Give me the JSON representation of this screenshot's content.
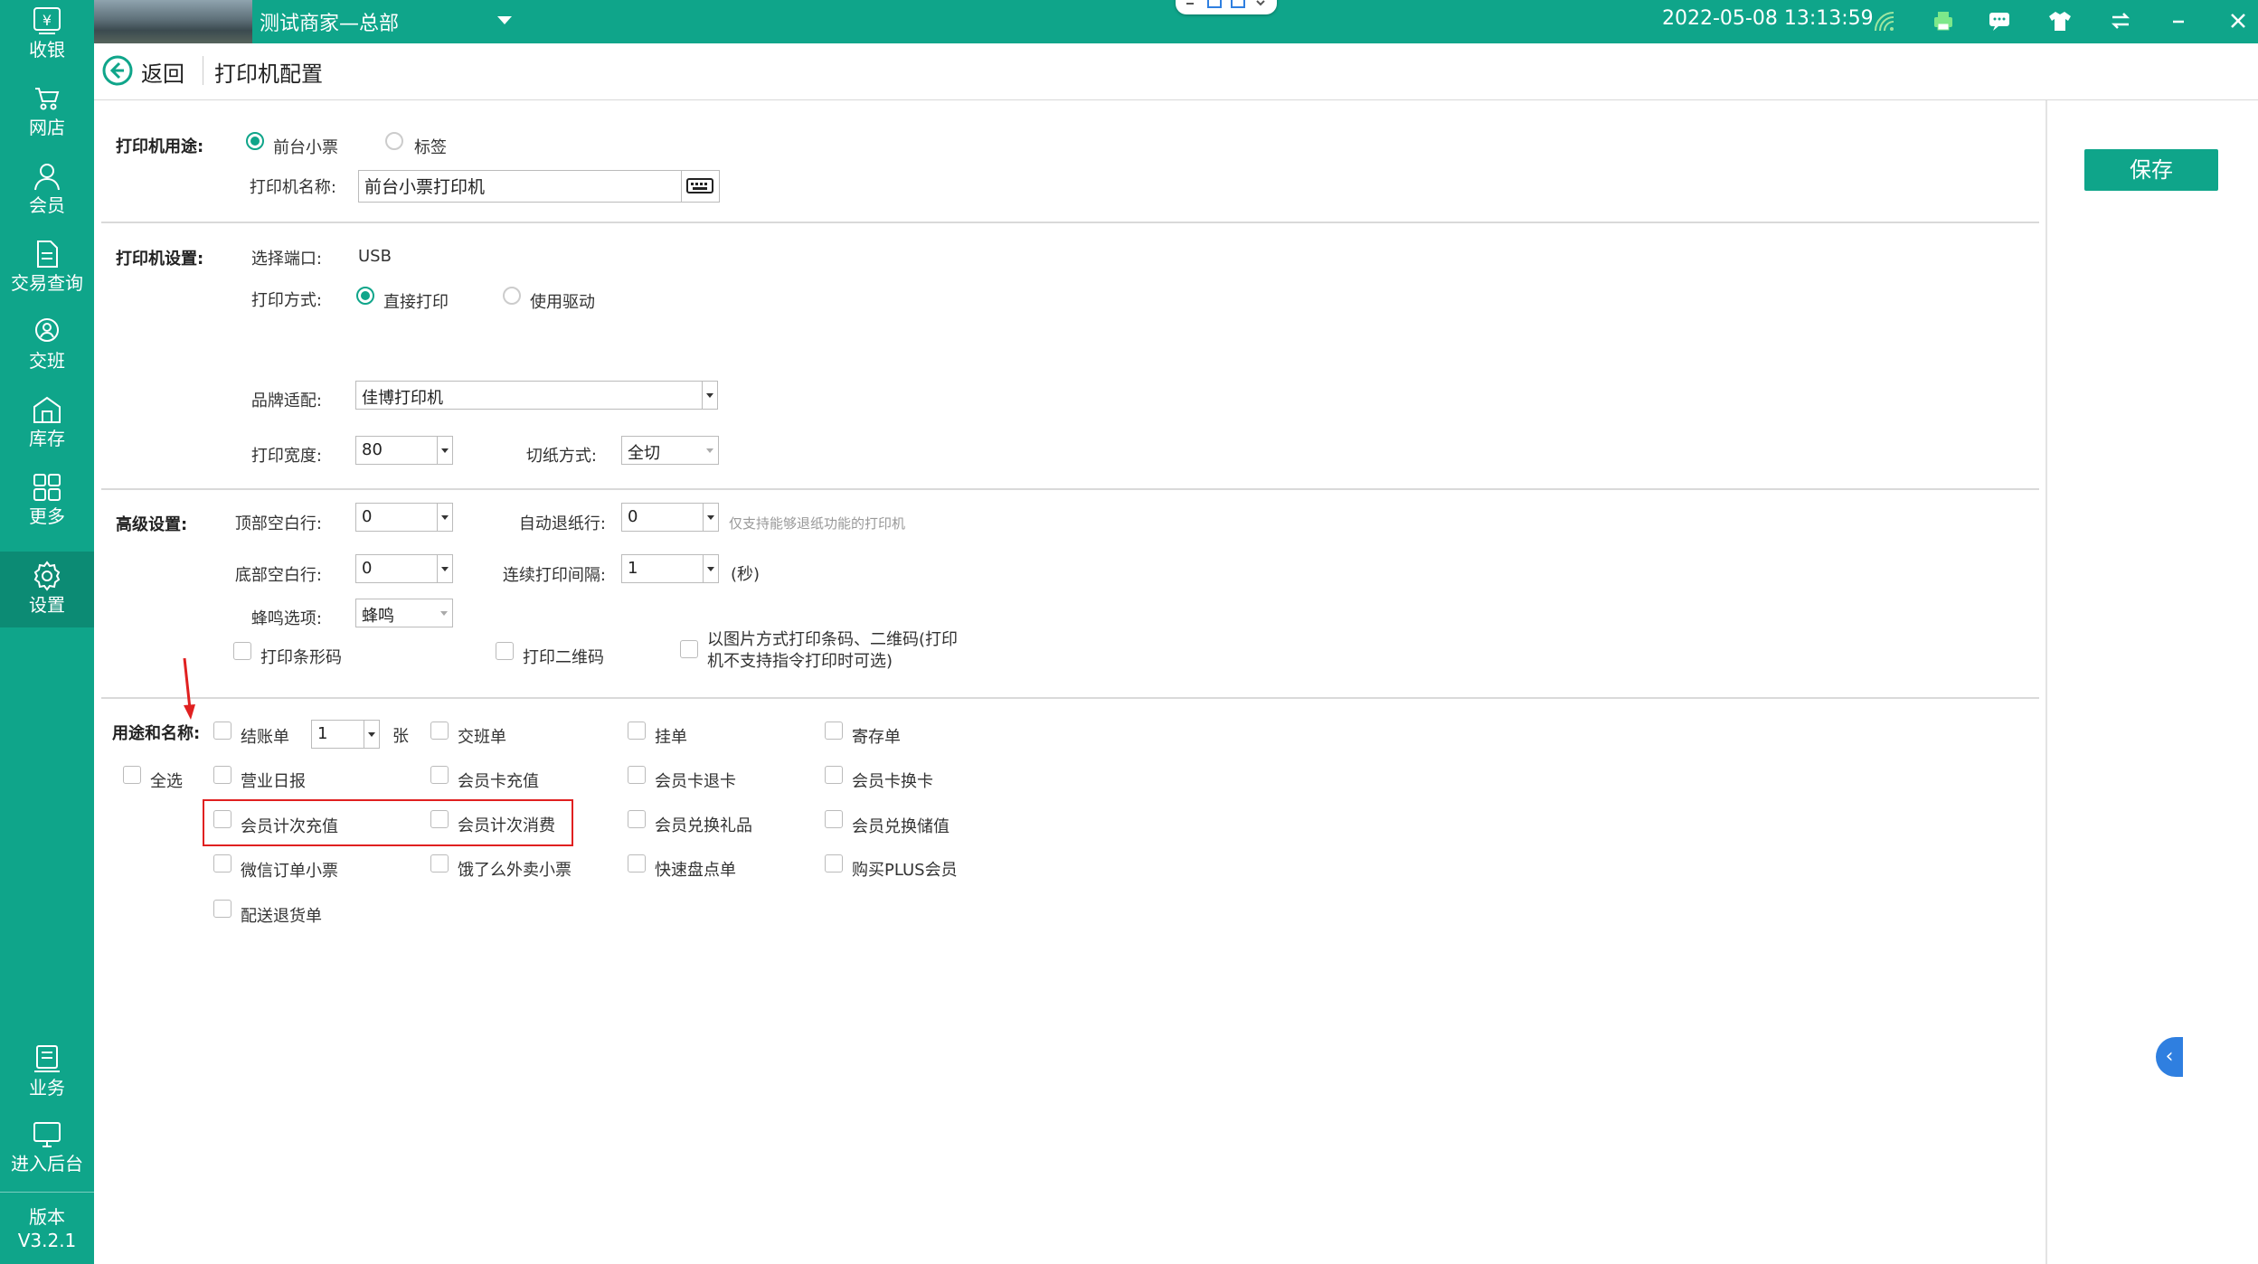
{
  "sidebar": {
    "items": [
      {
        "label": "收银",
        "icon": "cashier-icon"
      },
      {
        "label": "网店",
        "icon": "online-store-icon"
      },
      {
        "label": "会员",
        "icon": "member-icon"
      },
      {
        "label": "交易查询",
        "icon": "transaction-query-icon"
      },
      {
        "label": "交班",
        "icon": "shift-handover-icon"
      },
      {
        "label": "库存",
        "icon": "inventory-icon"
      },
      {
        "label": "更多",
        "icon": "more-icon"
      },
      {
        "label": "设置",
        "icon": "settings-gear-icon",
        "active": true
      },
      {
        "label": "业务",
        "icon": "business-icon"
      },
      {
        "label": "进入后台",
        "icon": "backend-monitor-icon"
      }
    ],
    "version_label": "版本",
    "version_number": "V3.2.1"
  },
  "topbar": {
    "store_name": "测试商家—总部",
    "datetime": "2022-05-08 13:13:59"
  },
  "header": {
    "back_label": "返回",
    "title": "打印机配置"
  },
  "save_label": "保存",
  "purpose": {
    "label": "打印机用途:",
    "options": [
      "前台小票",
      "标签"
    ],
    "selected": "前台小票",
    "name_label": "打印机名称:",
    "name_value": "前台小票打印机"
  },
  "printer_settings": {
    "label": "打印机设置:",
    "port_label": "选择端口:",
    "port_value": "USB",
    "method_label": "打印方式:",
    "method_options": [
      "直接打印",
      "使用驱动"
    ],
    "method_selected": "直接打印",
    "brand_label": "品牌适配:",
    "brand_value": "佳博打印机",
    "width_label": "打印宽度:",
    "width_value": "80",
    "cut_label": "切纸方式:",
    "cut_value": "全切"
  },
  "advanced": {
    "label": "高级设置:",
    "top_blank_label": "顶部空白行:",
    "top_blank_value": "0",
    "auto_retract_label": "自动退纸行:",
    "auto_retract_value": "0",
    "auto_retract_note": "仅支持能够退纸功能的打印机",
    "bottom_blank_label": "底部空白行:",
    "bottom_blank_value": "0",
    "interval_label": "连续打印间隔:",
    "interval_value": "1",
    "interval_unit": "(秒)",
    "beep_label": "蜂鸣选项:",
    "beep_value": "蜂鸣",
    "barcode_label": "打印条形码",
    "qrcode_label": "打印二维码",
    "image_mode_line1": "以图片方式打印条码、二维码(打印",
    "image_mode_line2": "机不支持指令打印时可选)"
  },
  "usage": {
    "label": "用途和名称:",
    "select_all": "全选",
    "copies_value": "1",
    "copies_unit": "张",
    "items": [
      "结账单",
      "交班单",
      "挂单",
      "寄存单",
      "营业日报",
      "会员卡充值",
      "会员卡退卡",
      "会员卡换卡",
      "会员计次充值",
      "会员计次消费",
      "会员兑换礼品",
      "会员兑换储值",
      "微信订单小票",
      "饿了么外卖小票",
      "快速盘点单",
      "购买PLUS会员",
      "配送退货单"
    ]
  },
  "colors": {
    "brand": "#0fa58a",
    "highlight": "#e02020",
    "accent_blue": "#2f7fe0"
  }
}
